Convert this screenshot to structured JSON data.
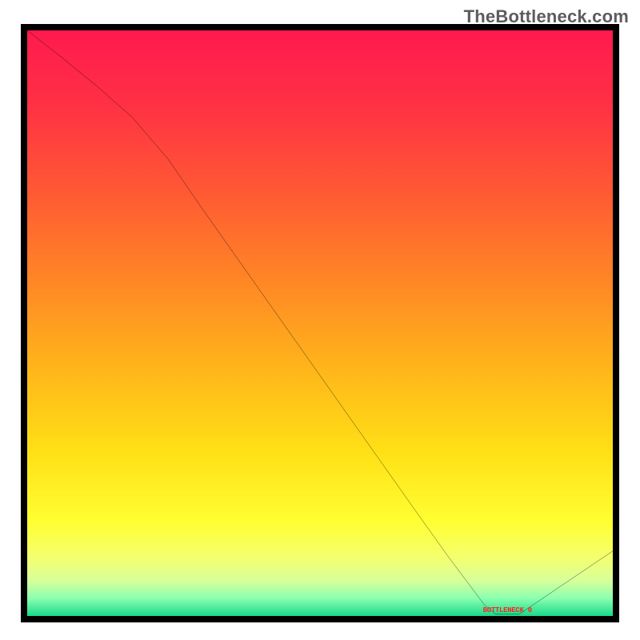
{
  "watermark": "TheBottleneck.com",
  "chart_data": {
    "type": "line",
    "title": "",
    "xlabel": "",
    "ylabel": "",
    "xlim": [
      0,
      100
    ],
    "ylim": [
      0,
      100
    ],
    "grid": false,
    "series": [
      {
        "name": "curve",
        "x": [
          0,
          6,
          12,
          18,
          24,
          30,
          36,
          42,
          48,
          54,
          60,
          66,
          72,
          78,
          80,
          84,
          88,
          92,
          96,
          100
        ],
        "y": [
          100,
          95.3,
          90.4,
          85.1,
          78.1,
          69.4,
          60.9,
          52.4,
          43.9,
          35.4,
          26.9,
          18.4,
          10.0,
          2.0,
          0.3,
          0.3,
          3.0,
          5.7,
          8.4,
          11.1
        ]
      }
    ],
    "min_marker": {
      "x": 82,
      "y": 0.3,
      "label": "BOTTLENECK 0"
    },
    "palette": {
      "frame": "#000000",
      "curve": "#000000",
      "grad_top": "#ff1a4e",
      "grad_bottom": "#1ad98b",
      "marker": "#ff2424"
    }
  }
}
